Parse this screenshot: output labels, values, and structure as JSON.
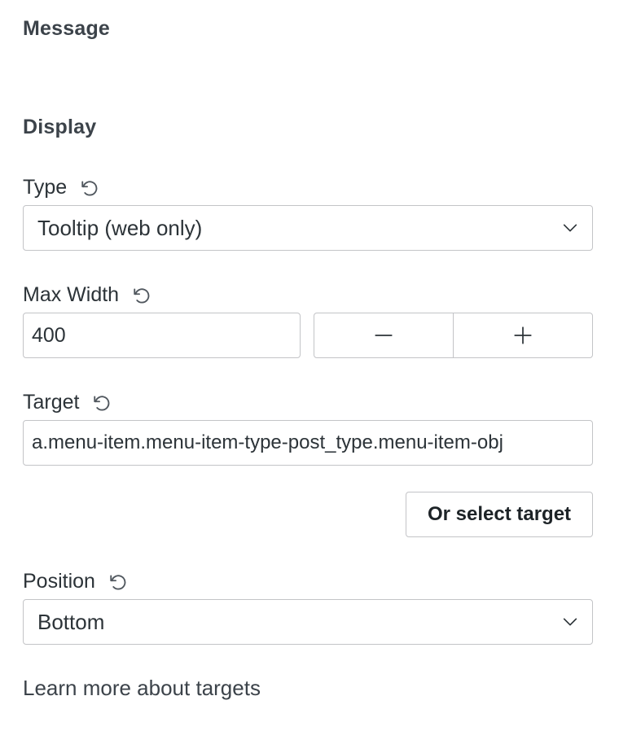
{
  "sections": {
    "message_title": "Message",
    "display_title": "Display"
  },
  "type_field": {
    "label": "Type",
    "value": "Tooltip (web only)",
    "reset_icon": "reset-icon"
  },
  "max_width_field": {
    "label": "Max Width",
    "value": "400",
    "decrement_icon": "minus-icon",
    "increment_icon": "plus-icon"
  },
  "target_field": {
    "label": "Target",
    "value": "a.menu-item.menu-item-type-post_type.menu-item-obj",
    "select_button": "Or select target"
  },
  "position_field": {
    "label": "Position",
    "value": "Bottom"
  },
  "learn_more_link": "Learn more about targets",
  "colors": {
    "border": "#c3c4c7",
    "text": "#2c3338",
    "heading": "#3c434a"
  }
}
